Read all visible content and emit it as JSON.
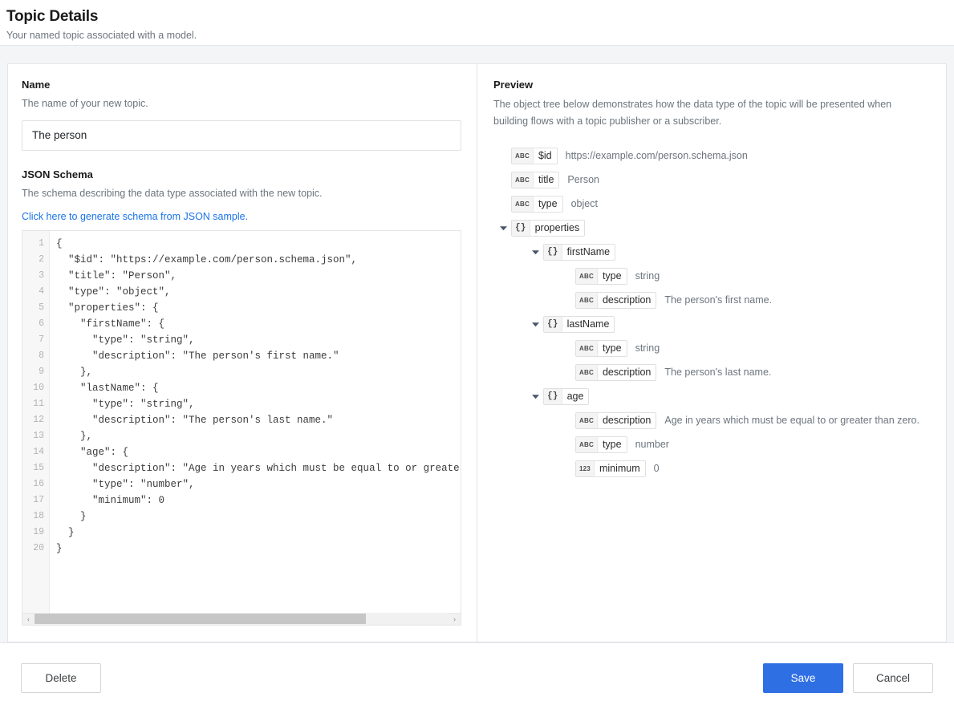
{
  "header": {
    "title": "Topic Details",
    "subtitle": "Your named topic associated with a model."
  },
  "form": {
    "name_label": "Name",
    "name_help": "The name of your new topic.",
    "name_value": "The person",
    "name_placeholder": "",
    "schema_label": "JSON Schema",
    "schema_help": "The schema describing the data type associated with the new topic.",
    "schema_link": "Click here to generate schema from JSON sample."
  },
  "editor": {
    "lines": [
      "{",
      "  \"$id\": \"https://example.com/person.schema.json\",",
      "  \"title\": \"Person\",",
      "  \"type\": \"object\",",
      "  \"properties\": {",
      "    \"firstName\": {",
      "      \"type\": \"string\",",
      "      \"description\": \"The person's first name.\"",
      "    },",
      "    \"lastName\": {",
      "      \"type\": \"string\",",
      "      \"description\": \"The person's last name.\"",
      "    },",
      "    \"age\": {",
      "      \"description\": \"Age in years which must be equal to or greater than zero.\",",
      "      \"type\": \"number\",",
      "      \"minimum\": 0",
      "    }",
      "  }",
      "}"
    ],
    "line_numbers": [
      1,
      2,
      3,
      4,
      5,
      6,
      7,
      8,
      9,
      10,
      11,
      12,
      13,
      14,
      15,
      16,
      17,
      18,
      19,
      20
    ],
    "scroll_left_arrow": "‹",
    "scroll_right_arrow": "›"
  },
  "preview": {
    "title": "Preview",
    "description": "The object tree below demonstrates how the data type of the topic will be presented when building flows with a topic publisher or a subscriber.",
    "tree": [
      {
        "badge": "ABC",
        "type": "string",
        "key": "$id",
        "value": "https://example.com/person.schema.json",
        "indent": 0,
        "arrow": false
      },
      {
        "badge": "ABC",
        "type": "string",
        "key": "title",
        "value": "Person",
        "indent": 0,
        "arrow": false
      },
      {
        "badge": "ABC",
        "type": "string",
        "key": "type",
        "value": "object",
        "indent": 0,
        "arrow": false
      },
      {
        "badge": "{}",
        "type": "object",
        "key": "properties",
        "value": "",
        "indent": 0,
        "arrow": true
      },
      {
        "badge": "{}",
        "type": "object",
        "key": "firstName",
        "value": "",
        "indent": 1,
        "arrow": true
      },
      {
        "badge": "ABC",
        "type": "string",
        "key": "type",
        "value": "string",
        "indent": 2,
        "arrow": false
      },
      {
        "badge": "ABC",
        "type": "string",
        "key": "description",
        "value": "The person's first name.",
        "indent": 2,
        "arrow": false
      },
      {
        "badge": "{}",
        "type": "object",
        "key": "lastName",
        "value": "",
        "indent": 1,
        "arrow": true
      },
      {
        "badge": "ABC",
        "type": "string",
        "key": "type",
        "value": "string",
        "indent": 2,
        "arrow": false
      },
      {
        "badge": "ABC",
        "type": "string",
        "key": "description",
        "value": "The person's last name.",
        "indent": 2,
        "arrow": false
      },
      {
        "badge": "{}",
        "type": "object",
        "key": "age",
        "value": "",
        "indent": 1,
        "arrow": true
      },
      {
        "badge": "ABC",
        "type": "string",
        "key": "description",
        "value": "Age in years which must be equal to or greater than zero.",
        "indent": 2,
        "arrow": false
      },
      {
        "badge": "ABC",
        "type": "string",
        "key": "type",
        "value": "number",
        "indent": 2,
        "arrow": false
      },
      {
        "badge": "123",
        "type": "number",
        "key": "minimum",
        "value": "0",
        "indent": 2,
        "arrow": false
      }
    ]
  },
  "footer": {
    "delete_label": "Delete",
    "save_label": "Save",
    "cancel_label": "Cancel"
  },
  "colors": {
    "primary": "#2f6fe4",
    "link": "#1a73e8",
    "page_bg": "#f4f5f6",
    "border": "#e3e5e8"
  }
}
